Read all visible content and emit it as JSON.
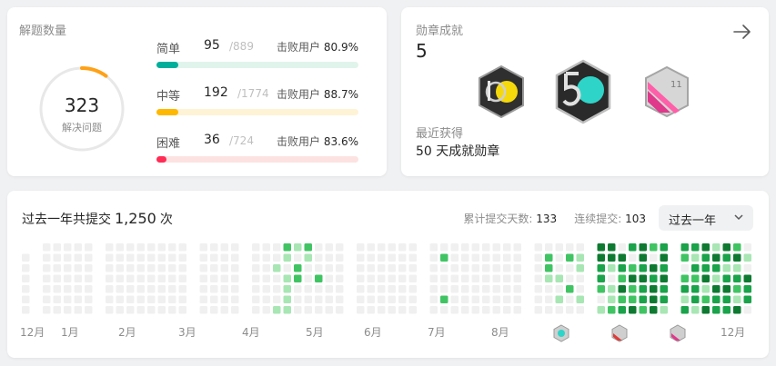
{
  "solved": {
    "title": "解题数量",
    "total": "323",
    "subtitle": "解决问题",
    "ring_fraction": 0.1,
    "difficulties": [
      {
        "name": "简单",
        "solved": "95",
        "total": "/889",
        "beat_label": "击败用户",
        "beat_value": "80.9%",
        "color": "#00af9b",
        "track": "#e0f4ec",
        "fraction": 0.107
      },
      {
        "name": "中等",
        "solved": "192",
        "total": "/1774",
        "beat_label": "击败用户",
        "beat_value": "88.7%",
        "color": "#ffb800",
        "track": "#fff3d6",
        "fraction": 0.108
      },
      {
        "name": "困难",
        "solved": "36",
        "total": "/724",
        "beat_label": "击败用户",
        "beat_value": "83.6%",
        "color": "#ff2d55",
        "track": "#fde2e2",
        "fraction": 0.05
      }
    ]
  },
  "badges": {
    "title": "勋章成就",
    "count": "5",
    "arrow_icon": "arrow-right-icon",
    "items": [
      {
        "name": "100-days-badge",
        "label": "100"
      },
      {
        "name": "50-days-badge",
        "label": "50"
      },
      {
        "name": "monthly-badge",
        "label": "11"
      }
    ],
    "recent_label": "最近获得",
    "recent_value": "50 天成就勋章"
  },
  "heatmap": {
    "title_prefix": "过去一年共提交",
    "total": "1,250",
    "title_suffix": "次",
    "stats": {
      "days_label": "累计提交天数:",
      "days_value": "133",
      "streak_label": "连续提交:",
      "streak_value": "103"
    },
    "range": "过去一年",
    "months": [
      "12月",
      "1月",
      "2月",
      "3月",
      "4月",
      "5月",
      "6月",
      "7月",
      "8月",
      "12月"
    ],
    "colors": {
      "empty": "#f0f0f0",
      "l1": "#a8e6b4",
      "l2": "#40c463",
      "l3": "#1aa34a",
      "l4": "#0e7a31"
    }
  }
}
